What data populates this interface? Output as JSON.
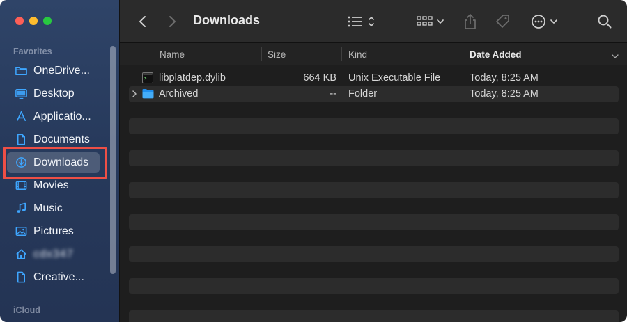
{
  "window": {
    "title": "Downloads"
  },
  "sidebar": {
    "sections": {
      "favorites": "Favorites",
      "icloud": "iCloud"
    },
    "items": [
      {
        "label": "OneDrive...",
        "icon": "cloud-folder-icon"
      },
      {
        "label": "Desktop",
        "icon": "desktop-icon"
      },
      {
        "label": "Applicatio...",
        "icon": "applications-icon"
      },
      {
        "label": "Documents",
        "icon": "document-icon"
      },
      {
        "label": "Downloads",
        "icon": "download-icon",
        "selected": true
      },
      {
        "label": "Movies",
        "icon": "movies-icon"
      },
      {
        "label": "Music",
        "icon": "music-icon"
      },
      {
        "label": "Pictures",
        "icon": "pictures-icon"
      },
      {
        "label": "cdx347",
        "icon": "home-icon",
        "blurred": true
      },
      {
        "label": "Creative...",
        "icon": "folder-icon"
      }
    ]
  },
  "toolbar": {
    "back_icon": "chevron-left-icon",
    "forward_icon": "chevron-right-icon",
    "view_icon": "list-view-icon",
    "group_icon": "grid-group-icon",
    "share_icon": "share-icon",
    "tag_icon": "tag-icon",
    "action_icon": "ellipsis-circle-icon",
    "search_icon": "search-icon"
  },
  "columns": {
    "name": "Name",
    "size": "Size",
    "kind": "Kind",
    "date_added": "Date Added"
  },
  "files": [
    {
      "name": "libplatdep.dylib",
      "size": "664 KB",
      "kind": "Unix Executable File",
      "date": "Today, 8:25 AM",
      "icon": "executable-file-icon"
    },
    {
      "name": "Archived",
      "size": "--",
      "kind": "Folder",
      "date": "Today, 8:25 AM",
      "icon": "folder-icon"
    }
  ],
  "colors": {
    "sidebar_top": "#2f4468",
    "highlight": "#ee4f46",
    "folder_blue": "#2f9ef5"
  }
}
